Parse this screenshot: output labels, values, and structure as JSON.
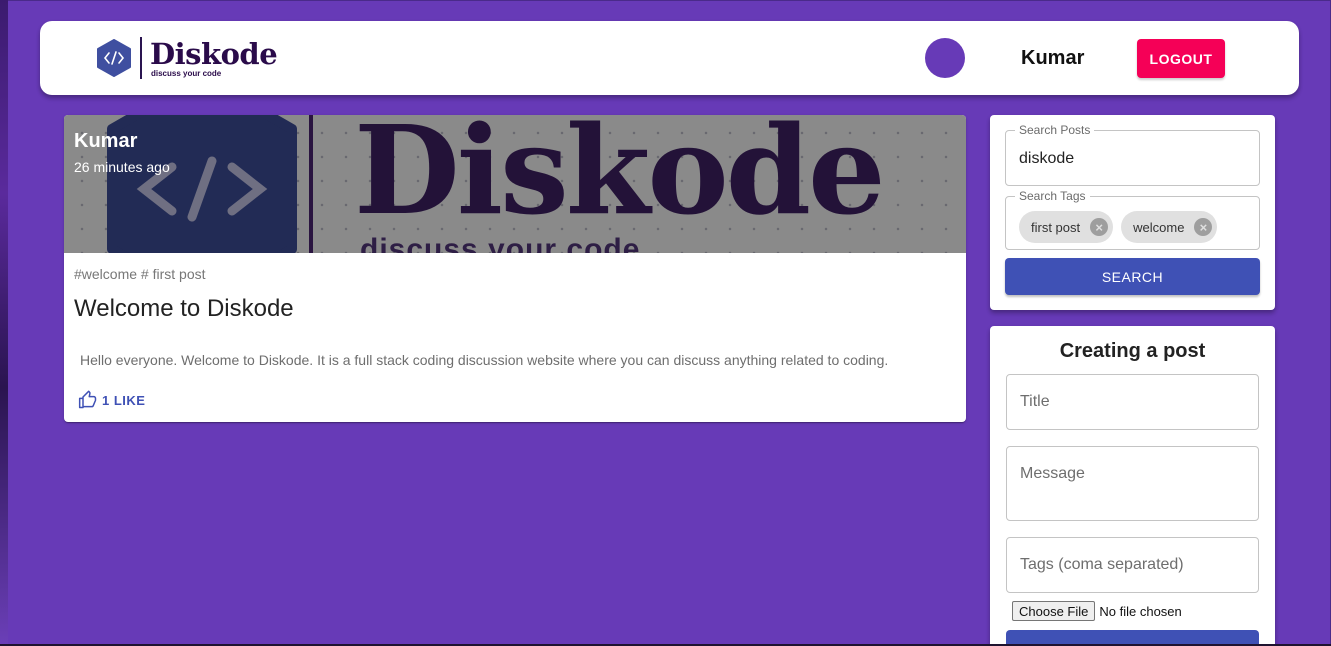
{
  "app": {
    "brand_name": "Diskode",
    "brand_tagline": "discuss your code",
    "user_name": "Kumar",
    "logout_label": "LOGOUT"
  },
  "post": {
    "author": "Kumar",
    "time": "26 minutes ago",
    "media_word": "Diskode",
    "media_tagline": "discuss your code",
    "tags": "#welcome # first post",
    "title": "Welcome to Diskode",
    "message": "Hello everyone. Welcome to Diskode. It is a full stack coding discussion website where you can discuss anything related to coding.",
    "like_label": "1 LIKE"
  },
  "search": {
    "posts_label": "Search Posts",
    "posts_value": "diskode",
    "tags_label": "Search Tags",
    "chips": [
      "first post",
      "welcome"
    ],
    "button_label": "SEARCH"
  },
  "create": {
    "heading": "Creating a post",
    "title_placeholder": "Title",
    "message_placeholder": "Message",
    "tags_placeholder": "Tags (coma separated)",
    "file_button": "Choose File",
    "file_status": "No file chosen"
  },
  "colors": {
    "background": "#673ab7",
    "logout": "#f50057",
    "primary": "#3f51b5",
    "avatar": "#673ab7"
  },
  "icons": {
    "brand": "code-hexagon-icon",
    "like": "thumb-up-icon",
    "chip_delete": "cancel-circle-icon"
  }
}
